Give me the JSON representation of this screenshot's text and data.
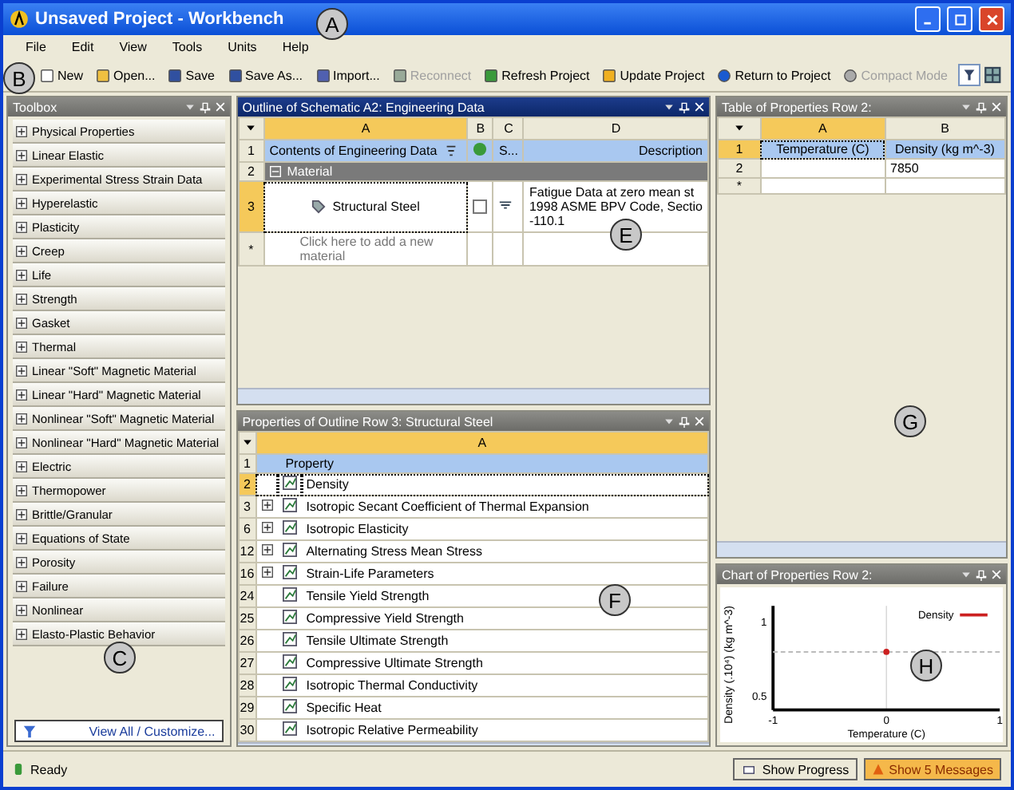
{
  "window": {
    "title": "Unsaved Project - Workbench"
  },
  "menu": [
    "File",
    "Edit",
    "View",
    "Tools",
    "Units",
    "Help"
  ],
  "toolbar": [
    {
      "label": "New",
      "disabled": false
    },
    {
      "label": "Open...",
      "disabled": false
    },
    {
      "label": "Save",
      "disabled": false
    },
    {
      "label": "Save As...",
      "disabled": false
    },
    {
      "label": "Import...",
      "disabled": false
    },
    {
      "label": "Reconnect",
      "disabled": true
    },
    {
      "label": "Refresh Project",
      "disabled": false
    },
    {
      "label": "Update Project",
      "disabled": false
    },
    {
      "label": "Return to Project",
      "disabled": false
    },
    {
      "label": "Compact Mode",
      "disabled": true
    }
  ],
  "toolbox": {
    "title": "Toolbox",
    "items": [
      "Physical Properties",
      "Linear Elastic",
      "Experimental Stress Strain Data",
      "Hyperelastic",
      "Plasticity",
      "Creep",
      "Life",
      "Strength",
      "Gasket",
      "Thermal",
      "Linear \"Soft\" Magnetic Material",
      "Linear \"Hard\" Magnetic Material",
      "Nonlinear \"Soft\" Magnetic Material",
      "Nonlinear \"Hard\" Magnetic Material",
      "Electric",
      "Thermopower",
      "Brittle/Granular",
      "Equations of State",
      "Porosity",
      "Failure",
      "Nonlinear",
      "Elasto-Plastic Behavior"
    ],
    "footer": "View All / Customize..."
  },
  "outline": {
    "title": "Outline of Schematic A2: Engineering Data",
    "columns": [
      "A",
      "B",
      "C",
      "D"
    ],
    "header": {
      "num": "1",
      "contents": "Contents of Engineering Data",
      "column_c": "S...",
      "description": "Description"
    },
    "group": {
      "num": "2",
      "label": "Material",
      "expanded": true
    },
    "rows": [
      {
        "num": "3",
        "name": "Structural Steel",
        "checked": false,
        "selected": true,
        "description": [
          "Fatigue Data at zero mean st",
          "1998 ASME BPV Code, Sectio",
          "-110.1"
        ]
      }
    ],
    "new_row": {
      "num": "*",
      "placeholder": "Click here to add a new material"
    }
  },
  "properties": {
    "title": "Properties of Outline Row 3: Structural Steel",
    "column": "A",
    "header": {
      "num": "1",
      "label": "Property"
    },
    "rows": [
      {
        "num": "2",
        "name": "Density",
        "expandable": false,
        "selected": true
      },
      {
        "num": "3",
        "name": "Isotropic Secant Coefficient of Thermal Expansion",
        "expandable": true,
        "selected": false
      },
      {
        "num": "6",
        "name": "Isotropic Elasticity",
        "expandable": true,
        "selected": false
      },
      {
        "num": "12",
        "name": "Alternating Stress Mean Stress",
        "expandable": true,
        "selected": false
      },
      {
        "num": "16",
        "name": "Strain-Life Parameters",
        "expandable": true,
        "selected": false
      },
      {
        "num": "24",
        "name": "Tensile Yield Strength",
        "expandable": false,
        "selected": false
      },
      {
        "num": "25",
        "name": "Compressive Yield Strength",
        "expandable": false,
        "selected": false
      },
      {
        "num": "26",
        "name": "Tensile Ultimate Strength",
        "expandable": false,
        "selected": false
      },
      {
        "num": "27",
        "name": "Compressive Ultimate Strength",
        "expandable": false,
        "selected": false
      },
      {
        "num": "28",
        "name": "Isotropic Thermal Conductivity",
        "expandable": false,
        "selected": false
      },
      {
        "num": "29",
        "name": "Specific Heat",
        "expandable": false,
        "selected": false
      },
      {
        "num": "30",
        "name": "Isotropic Relative Permeability",
        "expandable": false,
        "selected": false
      }
    ]
  },
  "table": {
    "title": "Table of Properties Row 2:",
    "columns": [
      "A",
      "B"
    ],
    "rows": [
      {
        "num": "1",
        "cells": [
          "Temperature (C)",
          "Density (kg m^-3)"
        ],
        "selected": true
      },
      {
        "num": "2",
        "cells": [
          "",
          "7850"
        ],
        "selected": false
      },
      {
        "num": "*",
        "cells": [
          "",
          ""
        ],
        "selected": false
      }
    ]
  },
  "chart": {
    "title": "Chart of Properties Row 2:",
    "chart_data": {
      "type": "scatter",
      "xlabel": "Temperature (C)",
      "ylabel": "Density (.10⁴) (kg m^-3)",
      "x": [
        0
      ],
      "series": [
        {
          "name": "Density",
          "color": "#cc2020",
          "values": [
            0.79
          ]
        }
      ],
      "xlim": [
        -1,
        1
      ],
      "ylim": [
        0.4,
        1.1
      ],
      "xticks": [
        -1,
        0,
        1
      ],
      "yticks": [
        0.5,
        1
      ],
      "ref_lines": [
        {
          "axis": "y",
          "value": 0.79
        }
      ]
    }
  },
  "status": {
    "text": "Ready",
    "buttons": [
      "Show Progress",
      "Show 5 Messages"
    ]
  },
  "callouts": [
    "A",
    "B",
    "C",
    "E",
    "F",
    "G",
    "H"
  ]
}
